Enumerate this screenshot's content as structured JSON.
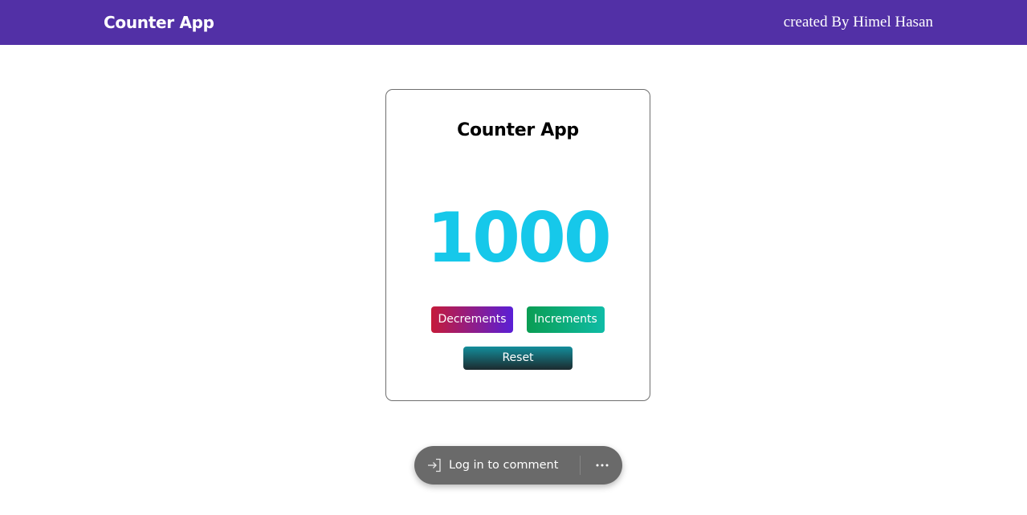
{
  "navbar": {
    "brand": "Counter App",
    "credit": "created By Himel Hasan",
    "background": "#5230a6"
  },
  "card": {
    "title": "Counter App",
    "count": "1000",
    "count_color": "#16c8ea",
    "buttons": {
      "decrement_label": "Decrements",
      "increment_label": "Increments",
      "reset_label": "Reset"
    }
  },
  "comment_bar": {
    "login_label": "Log in to comment",
    "login_icon": "login-icon",
    "more_icon": "more-icon"
  }
}
